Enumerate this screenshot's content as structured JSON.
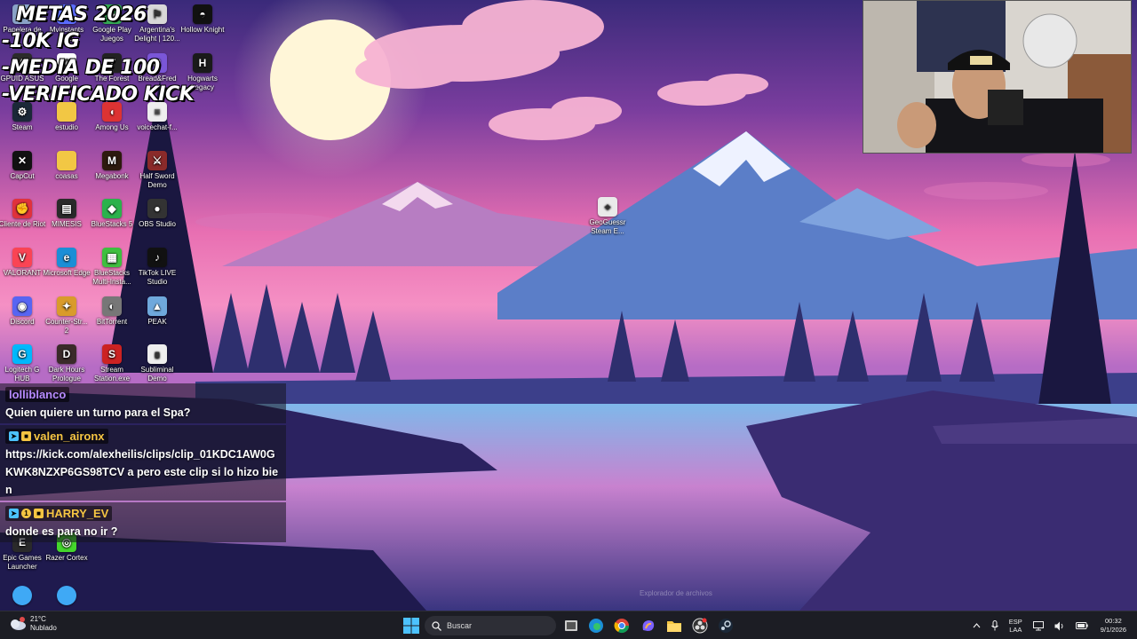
{
  "overlay": {
    "metas_lines": [
      "METAS 2026",
      "-10K IG",
      "-MEDIA DE 100",
      "-VERIFICADO KICK"
    ]
  },
  "desktop_icons": [
    {
      "label": "Papelera de",
      "icon": "recycle-bin-icon"
    },
    {
      "label": "Mvinstants App",
      "icon": "app-icon"
    },
    {
      "label": "Google Play Juegos",
      "icon": "google-play-icon"
    },
    {
      "label": "Argentina's Delight | 120...",
      "icon": "game-icon"
    },
    {
      "label": "Hollow Knight",
      "icon": "hollow-knight-icon"
    },
    {
      "label": "GPUID ASUS",
      "icon": "asus-icon"
    },
    {
      "label": "Google",
      "icon": "google-icon"
    },
    {
      "label": "The Forest",
      "icon": "the-forest-icon"
    },
    {
      "label": "Bread&Fred",
      "icon": "bread-fred-icon"
    },
    {
      "label": "Hogwarts Legacy",
      "icon": "hogwarts-icon"
    },
    {
      "label": "Steam",
      "icon": "steam-icon"
    },
    {
      "label": "estudio",
      "icon": "folder-icon"
    },
    {
      "label": "Among Us",
      "icon": "among-us-icon"
    },
    {
      "label": "voicechat-f...",
      "icon": "file-icon"
    },
    {
      "label": "CapCut",
      "icon": "capcut-icon"
    },
    {
      "label": "coasas",
      "icon": "folder-icon"
    },
    {
      "label": "Megabonk",
      "icon": "megabonk-icon"
    },
    {
      "label": "Half Sword Demo",
      "icon": "half-sword-icon"
    },
    {
      "label": "Cliente de Riot",
      "icon": "riot-icon"
    },
    {
      "label": "MIMESIS",
      "icon": "mimesis-icon"
    },
    {
      "label": "BlueStacks 5",
      "icon": "bluestacks-icon"
    },
    {
      "label": "OBS Studio",
      "icon": "obs-icon"
    },
    {
      "label": "VALORANT",
      "icon": "valorant-icon"
    },
    {
      "label": "Microsoft Edge",
      "icon": "edge-icon"
    },
    {
      "label": "BlueStacks Multi-Insta...",
      "icon": "bluestacks-multi-icon"
    },
    {
      "label": "TikTok LIVE Studio",
      "icon": "tiktok-icon"
    },
    {
      "label": "Discord",
      "icon": "discord-icon"
    },
    {
      "label": "Counter-Str... 2",
      "icon": "cs2-icon"
    },
    {
      "label": "BitTorrent",
      "icon": "bittorrent-icon"
    },
    {
      "label": "PEAK",
      "icon": "peak-icon"
    },
    {
      "label": "Logitech G HUB",
      "icon": "logitech-icon"
    },
    {
      "label": "Dark Hours Prologue",
      "icon": "dark-hours-icon"
    },
    {
      "label": "Stream Station.exe",
      "icon": "stream-station-icon"
    },
    {
      "label": "Subliminal Demo",
      "icon": "subliminal-icon"
    },
    {
      "label": "Epic Games Launcher",
      "icon": "epic-games-icon"
    },
    {
      "label": "Razer Cortex",
      "icon": "razer-icon"
    },
    {
      "label": "GeoGuessr Steam E...",
      "icon": "geoguessr-icon"
    }
  ],
  "chat": [
    {
      "user": "lolliblanco",
      "user_color": "#b98bff",
      "badges": [],
      "text": "Quien quiere un turno para el Spa?"
    },
    {
      "user": "valen_aironx",
      "user_color": "#f5c542",
      "badges": [
        "prime",
        "sub"
      ],
      "text": "https://kick.com/alexheilis/clips/clip_01KDC1AW0GKWK8NZXP6GS98TCV a pero este clip si lo hizo bien"
    },
    {
      "user": "HARRY_EV",
      "user_color": "#f5c542",
      "badges": [
        "prime",
        "gift",
        "sub"
      ],
      "text": "donde es para no ir ?"
    }
  ],
  "taskbar": {
    "weather_temp": "21°C",
    "weather_desc": "Nublado",
    "search_placeholder": "Buscar",
    "apps": [
      "task-view-icon",
      "edge-icon",
      "chrome-icon",
      "copilot-icon",
      "file-explorer-icon",
      "obs-icon",
      "steam-icon"
    ],
    "lang_line1": "ESP",
    "lang_line2": "LAA",
    "time": "00:32",
    "date": "9/1/2026"
  },
  "ghost_text": "Explorador de archivos",
  "colors": {
    "taskbar_bg": "#1c1d24",
    "accent_blue": "#4cc2ff",
    "username_gold": "#f5c542",
    "username_purple": "#b98bff"
  }
}
